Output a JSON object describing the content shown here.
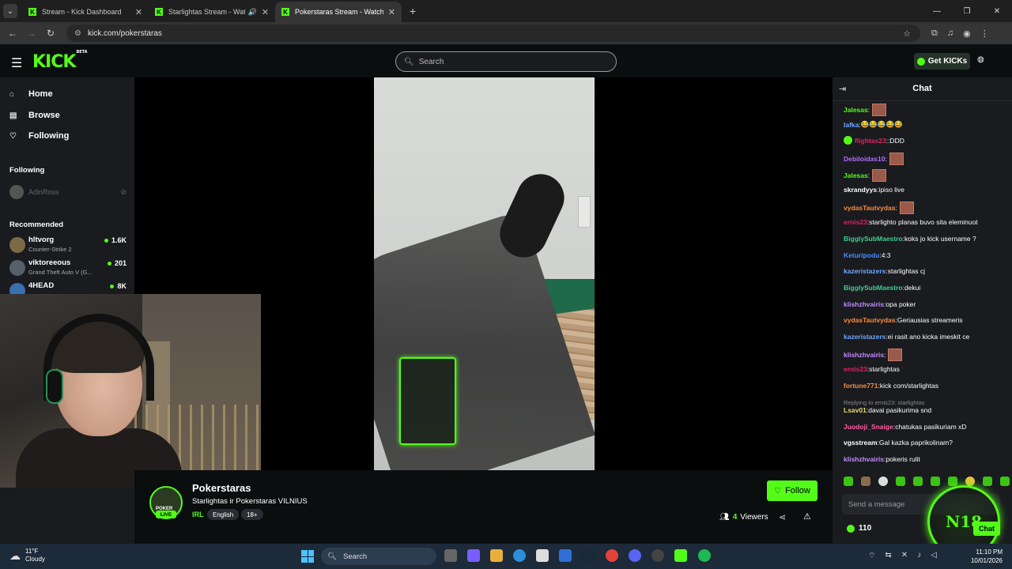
{
  "browser": {
    "tabs": [
      {
        "title": "Stream - Kick Dashboard"
      },
      {
        "title": "Starlightas Stream - Watch"
      },
      {
        "title": "Pokerstaras Stream - Watch Li"
      }
    ],
    "url": "kick.com/pokerstaras"
  },
  "header": {
    "logo": "KICK",
    "logo_badge": "BETA",
    "search_placeholder": "Search",
    "get_kicks_label": "Get KICKs"
  },
  "sidebar": {
    "nav": [
      {
        "label": "Home",
        "icon": "home-icon"
      },
      {
        "label": "Browse",
        "icon": "browse-icon"
      },
      {
        "label": "Following",
        "icon": "heart-icon"
      }
    ],
    "following_heading": "Following",
    "following": [
      {
        "name": "AdinRoss"
      }
    ],
    "recommended_heading": "Recommended",
    "recommended": [
      {
        "name": "hltvorg",
        "game": "Counter-Strike 2",
        "viewers": "1.6K"
      },
      {
        "name": "viktoreeous",
        "game": "Grand Theft Auto V (G...",
        "viewers": "201"
      },
      {
        "name": "4HEAD",
        "game": "",
        "viewers": "8K"
      }
    ]
  },
  "channel": {
    "name": "Pokerstaras",
    "title": "Starlightas ir Pokerstaras VILNIUS",
    "category": "IRL",
    "tags": [
      "English",
      "18+"
    ],
    "follow_label": "Follow",
    "viewers_count": "4",
    "viewers_label": "Viewers",
    "avatar_text": "POKER",
    "live_label": "LIVE"
  },
  "chat": {
    "title": "Chat",
    "messages": [
      {
        "user": "Jalesas",
        "color": "#53fc18",
        "text": "",
        "emote": true
      },
      {
        "user": "lafka",
        "color": "#6fa8ff",
        "text": "😂😂😂😂😂",
        "emote": false
      },
      {
        "user": "flightas23",
        "color": "#e0245e",
        "text": ":DDD",
        "emote": false
      },
      {
        "user": "Debiloidas10",
        "color": "#b46cff",
        "text": "",
        "emote": true
      },
      {
        "user": "Jalesas",
        "color": "#53fc18",
        "text": "",
        "emote": true
      },
      {
        "user": "skrandyys",
        "color": "#ffffff",
        "text": "ipiso live",
        "emote": false
      },
      {
        "user": "vydasTautvydas",
        "color": "#ff8a3d",
        "text": "",
        "emote": true
      },
      {
        "user": "ernis23",
        "color": "#e0245e",
        "text": "starlighto planas buvo sita eleminuot",
        "emote": false
      },
      {
        "user": "BigglySubMaestro",
        "color": "#3ecf8e",
        "text": "koks jo kick username ?",
        "emote": false
      },
      {
        "user": "Keturipodu",
        "color": "#4a8cff",
        "text": "4:3",
        "emote": false
      },
      {
        "user": "kazeristazers",
        "color": "#6fa8ff",
        "text": "starlightas cj",
        "emote": false
      },
      {
        "user": "BigglySubMaestro",
        "color": "#3ecf8e",
        "text": "dekui",
        "emote": false
      },
      {
        "user": "klishzhvairis",
        "color": "#c58bff",
        "text": "opa poker",
        "emote": false
      },
      {
        "user": "vydasTautvydas",
        "color": "#ff8a3d",
        "text": "Geriausias streameris",
        "emote": false
      },
      {
        "user": "kazeristazers",
        "color": "#6fa8ff",
        "text": "ei rasit ano kicka imeskit ce",
        "emote": false
      },
      {
        "user": "klishzhvairis",
        "color": "#c58bff",
        "text": "",
        "emote": true
      },
      {
        "user": "ernis23",
        "color": "#e0245e",
        "text": "starlightas",
        "emote": false
      },
      {
        "user": "fortune771",
        "color": "#ff8a3d",
        "text": "kick com/starlightas",
        "emote": false
      },
      {
        "user": "Lsav01",
        "color": "#e8d96b",
        "text": "davai pasikurima snd",
        "emote": false
      },
      {
        "user": "Juodoji_Snaige",
        "color": "#ff5fa2",
        "text": "chatukas pasikuriam xD",
        "emote": false
      },
      {
        "user": "vgsstream",
        "color": "#ffffff",
        "text": "Gal kazka paprikolinam?",
        "emote": false
      },
      {
        "user": "klishzhvairis",
        "color": "#c58bff",
        "text": "pokeris rulit",
        "emote": false
      }
    ],
    "reply_note": "Replying to ernis23: starlightas",
    "input_placeholder": "Send a message",
    "kicks_balance": "110",
    "chat_button_label": "Chat"
  },
  "overlay": {
    "n18_text": "N18"
  },
  "taskbar": {
    "temperature": "11°F",
    "weather": "Cloudy",
    "search_label": "Search",
    "time": "11:10 PM",
    "date": "10/01/2026"
  },
  "colors": {
    "accent": "#53fc18",
    "bg": "#0b0e0f",
    "panel": "#191b1f"
  }
}
